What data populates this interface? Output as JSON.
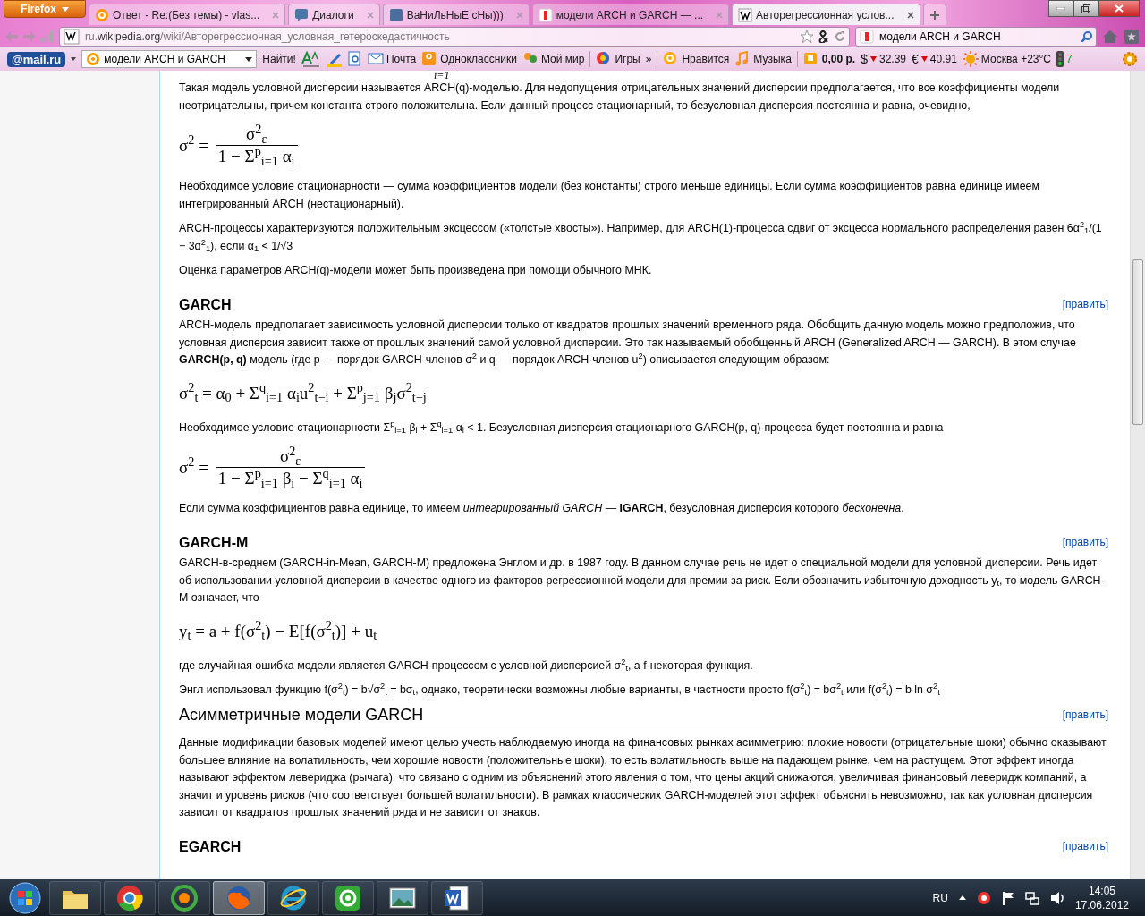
{
  "browser": {
    "menu_button": "Firefox",
    "tabs": [
      {
        "title": "Ответ - Re:(Без темы) - vlas...",
        "kind": "mail",
        "selected": false
      },
      {
        "title": "Диалоги",
        "kind": "chat",
        "selected": false
      },
      {
        "title": "ВаНиЛьНыЕ сНы)))",
        "kind": "vk",
        "selected": false
      },
      {
        "title": "модели ARCH и GARCH — ...",
        "kind": "yandex",
        "selected": false
      },
      {
        "title": "Авторегрессионная услов...",
        "kind": "wiki",
        "selected": true
      }
    ],
    "url": "ru.**wikipedia.org**/wiki/Авторегрессионная_условная_гетероскедастичность",
    "search": "модели ARCH и GARCH"
  },
  "mail_toolbar": {
    "logo": "@mail.ru",
    "search": "модели ARCH и GARCH",
    "find_button": "Найти!",
    "items": [
      {
        "kind": "mail",
        "label": "Почта"
      },
      {
        "kind": "ok",
        "label": "Одноклассники"
      },
      {
        "kind": "world",
        "label": "Мой мир"
      },
      {
        "kind": "games",
        "label": "Игры"
      },
      {
        "kind": "more",
        "label": "»"
      },
      {
        "kind": "like",
        "label": "Нравится"
      },
      {
        "kind": "music",
        "label": "Музыка"
      },
      {
        "kind": "wallet",
        "label": "0,00 р."
      },
      {
        "kind": "rate",
        "symbol": "$",
        "label": "32.39"
      },
      {
        "kind": "rate",
        "symbol": "€",
        "label": "40.91"
      },
      {
        "kind": "weather",
        "label": "Москва +23°C"
      },
      {
        "kind": "traffic",
        "label": "7"
      }
    ]
  },
  "article": [
    {
      "kind": "fragment",
      "text": "i=1"
    },
    {
      "kind": "paragraph",
      "text": "Такая модель условной дисперсии называется ARCH(q)-моделью. Для недопущения отрицательных значений дисперсии предполагается, что все коэффициенты модели неотрицательны, причем константа строго положительна. Если данный процесс стационарный, то безусловная дисперсия постоянна и равна, очевидно,"
    },
    {
      "kind": "fraction",
      "lhs": "σ$^{2}$ =",
      "numerator": "σ$^{2}$$_{ε}$",
      "denominator": "1 − Σ$^{p}$$_{i=1}$ α$_{i}$"
    },
    {
      "kind": "paragraph",
      "text": "Необходимое условие стационарности — сумма коэффициентов модели (без константы) строго меньше единицы. Если сумма коэффициентов равна единице имеем интегрированный ARCH (нестационарный)."
    },
    {
      "kind": "paragraph",
      "text": "ARCH-процессы характеризуются положительным эксцессом («толстые хвосты»). Например, для ARCH(1)-процесса сдвиг от эксцесса нормального распределения равен 6α$^{2}$$_{1}$/(1 − 3α$^{2}$$_{1}$), если α$_{1}$ < 1/√3"
    },
    {
      "kind": "paragraph",
      "text": "Оценка параметров ARCH(q)-модели может быть произведена при помощи обычного МНК."
    },
    {
      "kind": "heading",
      "text": "GARCH",
      "edit": "[править]"
    },
    {
      "kind": "paragraph",
      "text": "ARCH-модель предполагает зависимость условной дисперсии только от квадратов прошлых значений временного ряда. Обобщить данную модель можно предположив, что условная дисперсия зависит также от прошлых значений самой условной дисперсии. Это так называемый обобщенный ARCH (Generalized ARCH — GARCH). В этом случае **GARCH(p, q)** модель (где p — порядок GARCH-членов σ$^{2}$ и q — порядок ARCH-членов u$^{2}$) описывается следующим образом:"
    },
    {
      "kind": "formula",
      "text": "σ$^{2}$$_{t}$ = α$_{0}$ + Σ$^{q}$$_{i=1}$ α$_{i}$u$^{2}$$_{t−i}$ + Σ$^{p}$$_{j=1}$ β$_{j}$σ$^{2}$$_{t−j}$"
    },
    {
      "kind": "paragraph",
      "text": "Необходимое условие стационарности Σ$^{p}$$_{i=1}$ β$_{i}$ + Σ$^{q}$$_{i=1}$ α$_{i}$ < 1. Безусловная дисперсия стационарного GARCH(p, q)-процесса будет постоянна и равна"
    },
    {
      "kind": "fraction",
      "lhs": "σ$^{2}$ =",
      "numerator": "σ$^{2}$$_{ε}$",
      "denominator": "1 − Σ$^{p}$$_{i=1}$ β$_{i}$ − Σ$^{q}$$_{i=1}$ α$_{i}$"
    },
    {
      "kind": "paragraph",
      "text": "Если сумма коэффициентов равна единице, то имеем *интегрированный GARCH* — **IGARCH**, безусловная дисперсия которого *бесконечна*."
    },
    {
      "kind": "heading",
      "text": "GARCH-M",
      "edit": "[править]"
    },
    {
      "kind": "paragraph",
      "text": "GARCH-в-среднем (GARCH-in-Mean, GARCH-M) предложена Энглом и др. в 1987 году. В данном случае речь не идет о специальной модели для условной дисперсии. Речь идет об использовании условной дисперсии в качестве одного из факторов регрессионной модели для премии за риск. Если обозначить избыточную доходность y$_{t}$, то модель GARCH-M означает, что"
    },
    {
      "kind": "formula",
      "text": "y$_{t}$ = a + f(σ$^{2}$$_{t}$) − E[f(σ$^{2}$$_{t}$)] + u$_{t}$"
    },
    {
      "kind": "paragraph",
      "text": "где случайная ошибка модели является GARCH-процессом с условной дисперсией σ$^{2}$$_{t}$, а f-некоторая функция."
    },
    {
      "kind": "paragraph",
      "text": "Энгл использовал функцию f(σ$^{2}$$_{t}$) = b√σ$^{2}$$_{t}$ = bσ$_{t}$, однако, теоретически возможны любые варианты, в частности просто f(σ$^{2}$$_{t}$) = bσ$^{2}$$_{t}$ или f(σ$^{2}$$_{t}$) = b ln σ$^{2}$$_{t}$"
    },
    {
      "kind": "section",
      "text": "Асимметричные модели GARCH",
      "edit": "[править]"
    },
    {
      "kind": "paragraph",
      "text": "Данные модификации базовых моделей имеют целью учесть наблюдаемую иногда на финансовых рынках асимметрию: плохие новости (отрицательные шоки) обычно оказывают большее влияние на волатильность, чем хорошие новости (положительные шоки), то есть волатильность выше на падающем рынке, чем на растущем. Этот эффект иногда называют эффектом левериджа (рычага), что связано с одним из объяснений этого явления о том, что цены акций снижаются, увеличивая финансовый леверидж компаний, а значит и уровень рисков (что соответствует большей волатильности). В рамках классических GARCH-моделей этот эффект объяснить невозможно, так как условная дисперсия зависит от квадратов прошлых значений ряда и не зависит от знаков."
    },
    {
      "kind": "heading",
      "text": "EGARCH",
      "edit": "[править]"
    }
  ],
  "taskbar": {
    "apps": [
      {
        "kind": "folder",
        "selected": false
      },
      {
        "kind": "chrome",
        "selected": false
      },
      {
        "kind": "qip",
        "selected": false
      },
      {
        "kind": "firefox",
        "selected": true
      },
      {
        "kind": "ie",
        "selected": false
      },
      {
        "kind": "agent",
        "selected": false
      },
      {
        "kind": "photo",
        "selected": false
      },
      {
        "kind": "word",
        "selected": false
      }
    ],
    "language": "RU",
    "time": "14:05",
    "date": "17.06.2012"
  }
}
